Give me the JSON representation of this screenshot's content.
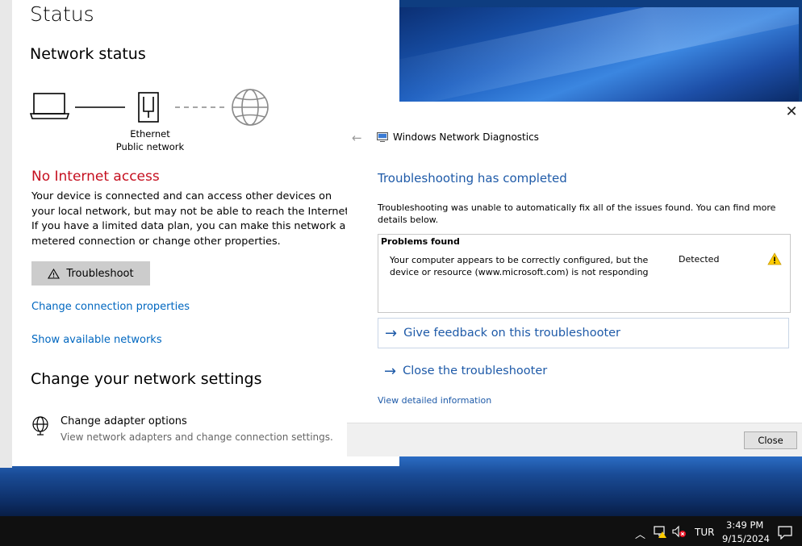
{
  "settings": {
    "page_title": "Status",
    "network_status_title": "Network status",
    "connection_type": "Ethernet",
    "network_profile": "Public network",
    "status_heading": "No Internet access",
    "status_description": "Your device is connected and can access other devices on your local network, but may not be able to reach the Internet. If you have a limited data plan, you can make this network a metered connection or change other properties.",
    "troubleshoot_label": "Troubleshoot",
    "change_connection_properties": "Change connection properties",
    "show_available_networks": "Show available networks",
    "change_settings_title": "Change your network settings",
    "adapter_options_title": "Change adapter options",
    "adapter_options_subtitle": "View network adapters and change connection settings."
  },
  "dialog": {
    "title": "Windows Network Diagnostics",
    "heading": "Troubleshooting has completed",
    "message": "Troubleshooting was unable to automatically fix all of the issues found. You can find more details below.",
    "problems_title": "Problems found",
    "problem_text": "Your computer appears to be correctly configured, but the device or resource (www.microsoft.com) is not responding",
    "problem_status": "Detected",
    "feedback_link": "Give feedback on this troubleshooter",
    "close_troubleshooter_link": "Close the troubleshooter",
    "detail_link": "View detailed information",
    "close_button": "Close"
  },
  "taskbar": {
    "language": "TUR",
    "time": "3:49 PM",
    "date": "9/15/2024"
  },
  "colors": {
    "error_red": "#c50f1f",
    "link_blue": "#0067c0",
    "dialog_blue": "#1e5aa8"
  },
  "icons": {
    "laptop": "laptop-icon",
    "ethernet": "ethernet-icon",
    "globe": "globe-icon",
    "warning": "warning-icon",
    "adapter": "globe-computer-icon"
  }
}
